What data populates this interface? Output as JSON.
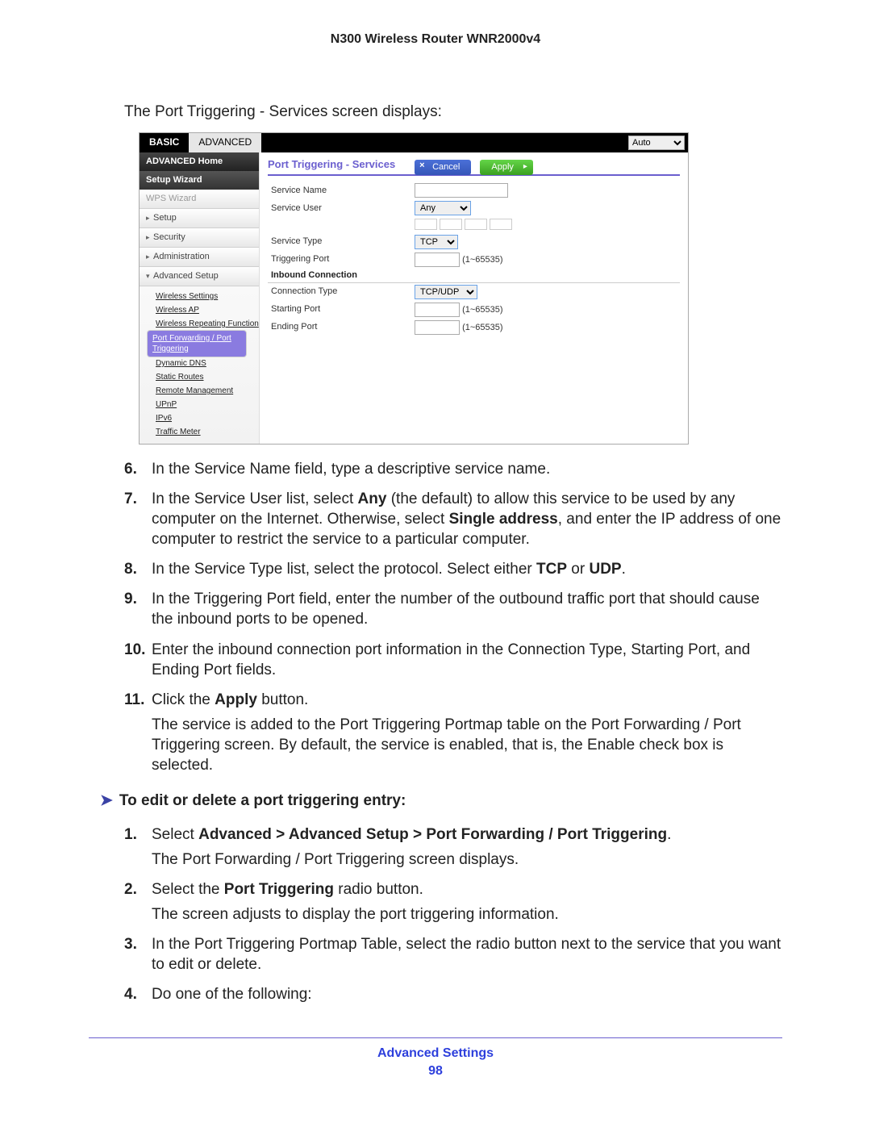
{
  "doc_title": "N300 Wireless Router WNR2000v4",
  "intro": "The Port Triggering - Services screen displays:",
  "router_ui": {
    "tabs": {
      "basic": "BASIC",
      "advanced": "ADVANCED"
    },
    "auto_dropdown": "Auto",
    "sidebar": {
      "advanced_home": "ADVANCED Home",
      "setup_wizard": "Setup Wizard",
      "wps_wizard": "WPS Wizard",
      "setup": "Setup",
      "security": "Security",
      "administration": "Administration",
      "advanced_setup": "Advanced Setup",
      "sub": {
        "wireless_settings": "Wireless Settings",
        "wireless_ap": "Wireless AP",
        "wireless_repeating": "Wireless Repeating Function",
        "port_forwarding": "Port Forwarding / Port Triggering",
        "dynamic_dns": "Dynamic DNS",
        "static_routes": "Static Routes",
        "remote_management": "Remote Management",
        "upnp": "UPnP",
        "ipv6": "IPv6",
        "traffic_meter": "Traffic Meter"
      }
    },
    "panel_title": "Port Triggering - Services",
    "buttons": {
      "cancel": "Cancel",
      "apply": "Apply"
    },
    "form": {
      "service_name_label": "Service Name",
      "service_user_label": "Service User",
      "service_user_value": "Any",
      "service_type_label": "Service Type",
      "service_type_value": "TCP",
      "triggering_port_label": "Triggering Port",
      "range_hint": "(1~65535)",
      "inbound_heading": "Inbound Connection",
      "connection_type_label": "Connection Type",
      "connection_type_value": "TCP/UDP",
      "starting_port_label": "Starting Port",
      "ending_port_label": "Ending Port"
    }
  },
  "steps1": {
    "s6": "In the Service Name field, type a descriptive service name.",
    "s7_prefix": "In the Service User list, select ",
    "s7_any": "Any",
    "s7_mid": " (the default) to allow this service to be used by any computer on the Internet. Otherwise, select ",
    "s7_single": "Single address",
    "s7_suffix": ", and enter the IP address of one computer to restrict the service to a particular computer.",
    "s8_prefix": "In the Service Type list, select the protocol. Select either ",
    "s8_tcp": "TCP",
    "s8_or": " or ",
    "s8_udp": "UDP",
    "s9": "In the Triggering Port field, enter the number of the outbound traffic port that should cause the inbound ports to be opened.",
    "s10": "Enter the inbound connection port information in the Connection Type, Starting Port, and Ending Port fields.",
    "s11_prefix": "Click the ",
    "s11_apply": "Apply",
    "s11_suffix": " button.",
    "s11_followup": "The service is added to the Port Triggering Portmap table on the Port Forwarding / Port Triggering screen. By default, the service is enabled, that is, the Enable check box is selected."
  },
  "task2_heading": "To edit or delete a port triggering entry:",
  "steps2": {
    "s1_prefix": "Select ",
    "s1_path": "Advanced > Advanced Setup > Port Forwarding / Port Triggering",
    "s1_followup": "The Port Forwarding / Port Triggering screen displays.",
    "s2_prefix": "Select the ",
    "s2_bold": "Port Triggering",
    "s2_suffix": " radio button.",
    "s2_followup": "The screen adjusts to display the port triggering information.",
    "s3": "In the Port Triggering Portmap Table, select the radio button next to the service that you want to edit or delete.",
    "s4": "Do one of the following:"
  },
  "footer": {
    "section": "Advanced Settings",
    "page": "98"
  }
}
